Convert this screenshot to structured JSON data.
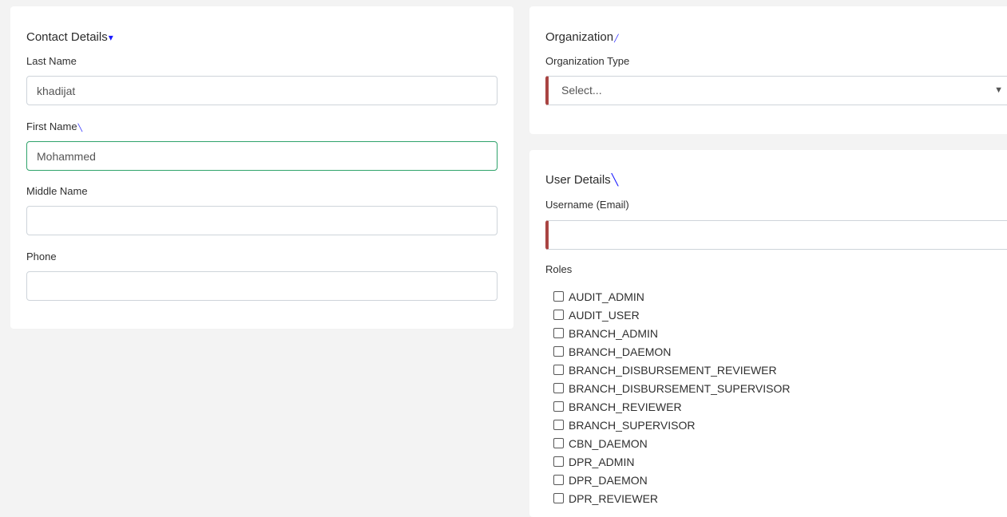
{
  "contact": {
    "title": "Contact Details",
    "title_mark": "▾",
    "last_name_label": "Last Name",
    "last_name_value": "khadijat",
    "first_name_label": "First Name",
    "first_name_mark": "╲",
    "first_name_value": "Mohammed",
    "middle_name_label": "Middle Name",
    "middle_name_value": "",
    "phone_label": "Phone",
    "phone_value": ""
  },
  "organization": {
    "title": "Organization",
    "title_mark": "╱",
    "type_label": "Organization Type",
    "type_selected": "Select...",
    "chevron_icon": "chevron-down-icon"
  },
  "user": {
    "title": "User Details",
    "title_mark": "╲",
    "username_label": "Username (Email)",
    "username_value": "",
    "roles_label": "Roles",
    "roles": [
      "AUDIT_ADMIN",
      "AUDIT_USER",
      "BRANCH_ADMIN",
      "BRANCH_DAEMON",
      "BRANCH_DISBURSEMENT_REVIEWER",
      "BRANCH_DISBURSEMENT_SUPERVISOR",
      "BRANCH_REVIEWER",
      "BRANCH_SUPERVISOR",
      "CBN_DAEMON",
      "DPR_ADMIN",
      "DPR_DAEMON",
      "DPR_REVIEWER"
    ]
  },
  "colors": {
    "required_accent": "#a94442",
    "focus_border": "#2fa36b",
    "annotation_mark": "#1a1aff"
  }
}
